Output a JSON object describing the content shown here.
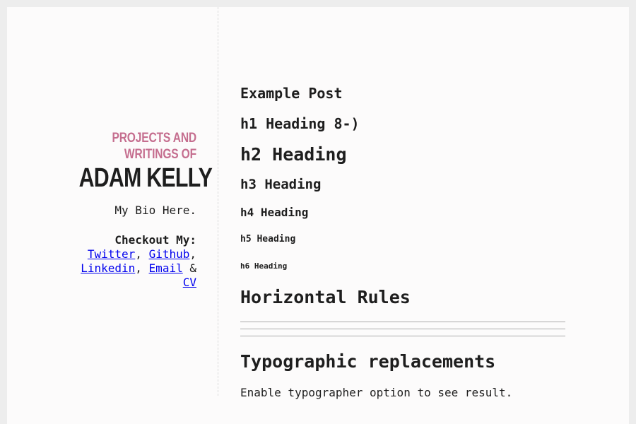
{
  "sidebar": {
    "subtitle_line1": "Projects and",
    "subtitle_line2": "Writings of",
    "name": "Adam Kelly",
    "bio": "My Bio Here.",
    "checkout_title": "Checkout My:",
    "links": {
      "twitter": "Twitter",
      "github": "Github",
      "linkedin": "Linkedin",
      "email": "Email",
      "cv": "CV"
    },
    "ampersand": "&"
  },
  "post": {
    "title": "Example Post",
    "headings": {
      "h1": "h1 Heading 8-)",
      "h2": "h2 Heading",
      "h3": "h3 Heading",
      "h4": "h4 Heading",
      "h5": "h5 Heading",
      "h6": "h6 Heading"
    },
    "horizontal_rules_heading": "Horizontal Rules",
    "typographic_heading": "Typographic replacements",
    "typographic_text": "Enable typographer option to see result."
  },
  "colors": {
    "page_background": "#ededed",
    "card_background": "#fcfbfb",
    "subtitle_accent": "#c56e8f",
    "text": "#1e1e1e",
    "link": "#0000ee",
    "rule": "#aaaaaa"
  }
}
